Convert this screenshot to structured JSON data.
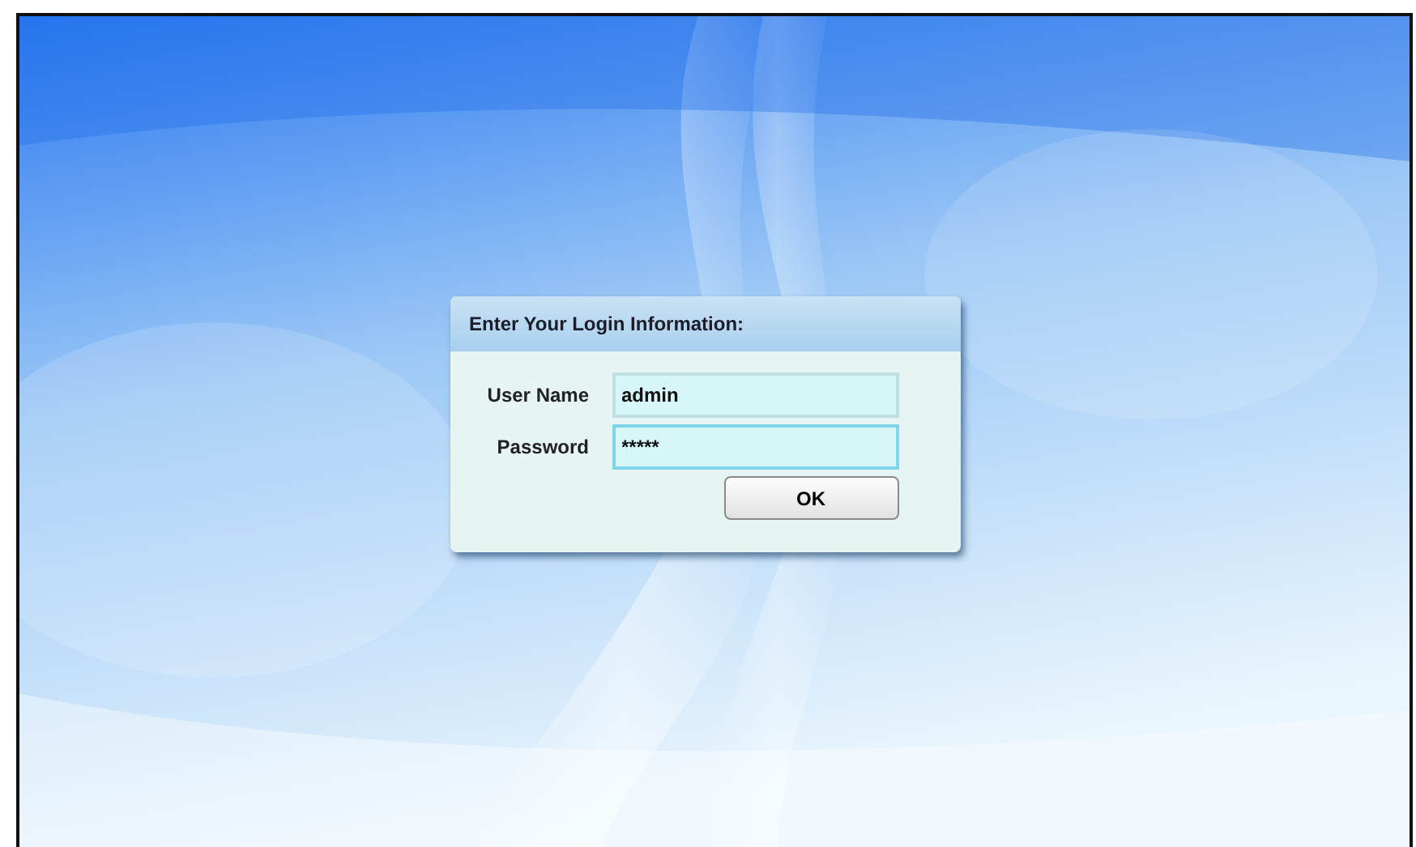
{
  "dialog": {
    "title": "Enter Your Login Information:",
    "fields": [
      {
        "label": "User Name",
        "value": "admin",
        "focused": false
      },
      {
        "label": "Password",
        "value": "*****",
        "focused": true
      }
    ],
    "buttons": [
      "OK"
    ]
  }
}
